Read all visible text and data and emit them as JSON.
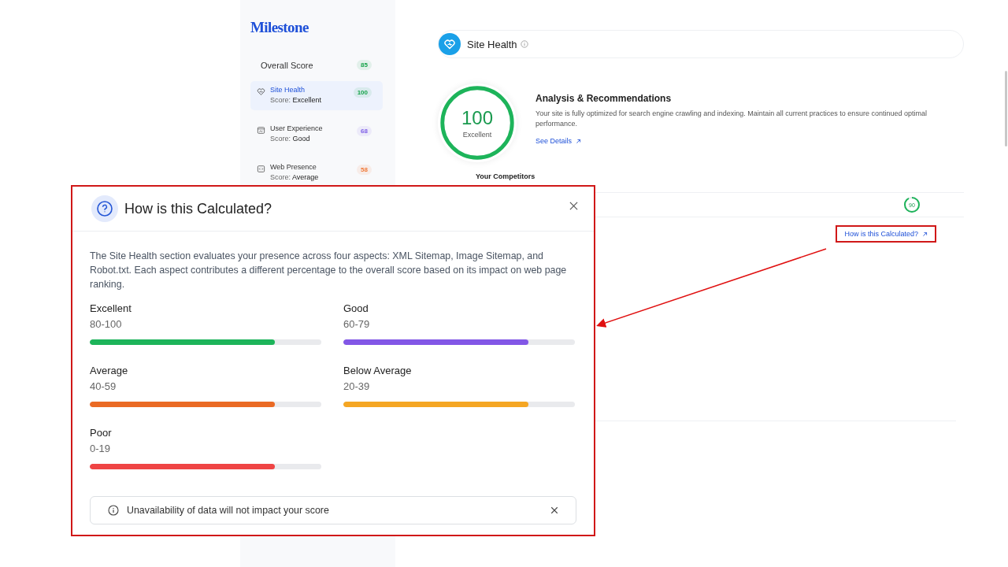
{
  "sidebar": {
    "logo": "Milestone",
    "overall": {
      "label": "Overall Score",
      "score": "85",
      "color": "#16a34a"
    },
    "items": [
      {
        "kind": "heart",
        "title": "Site Health",
        "score_text": "Score: **Excellent**",
        "score": "100",
        "color": "#16a34a",
        "selected": true
      },
      {
        "kind": "window",
        "title": "User Experience",
        "score_text": "Score: **Good**",
        "score": "68",
        "color": "#7c5ce6",
        "selected": false
      },
      {
        "kind": "code",
        "title": "Web Presence",
        "score_text": "Score: **Average**",
        "score": "58",
        "color": "#f07a3a",
        "selected": false
      }
    ]
  },
  "main": {
    "header": {
      "title": "Site Health"
    },
    "score": {
      "value": "100",
      "label": "Excellent",
      "level": 1
    },
    "analysis": {
      "title": "Analysis & Recommendations",
      "text": "Your site is fully optimized for search engine crawling and indexing. Maintain all current practices to ensure continued optimal performance.",
      "link": "See Details"
    },
    "competitors": {
      "title": "Your Competitors",
      "score": "90",
      "level": 0.92
    },
    "calc_link": "How is this Calculated?"
  },
  "modal": {
    "title": "How is this Calculated?",
    "description": "The Site Health section evaluates your presence across four aspects: XML Sitemap, Image Sitemap, and Robot.txt. Each aspect contributes a different percentage to the overall score based on its impact on web page ranking.",
    "ranges": [
      {
        "label": "Excellent",
        "range": "80-100",
        "level": 0.8,
        "color": "#1db45a"
      },
      {
        "label": "Good",
        "range": "60-79",
        "level": 0.8,
        "color": "#8257e6"
      },
      {
        "label": "Average",
        "range": "40-59",
        "level": 0.8,
        "color": "#ea6a24"
      },
      {
        "label": "Below Average",
        "range": "20-39",
        "level": 0.8,
        "color": "#f5a623"
      },
      {
        "label": "Poor",
        "range": "0-19",
        "level": 0.8,
        "color": "#ef4444"
      }
    ],
    "notice": "Unavailability of data will not impact your score"
  }
}
